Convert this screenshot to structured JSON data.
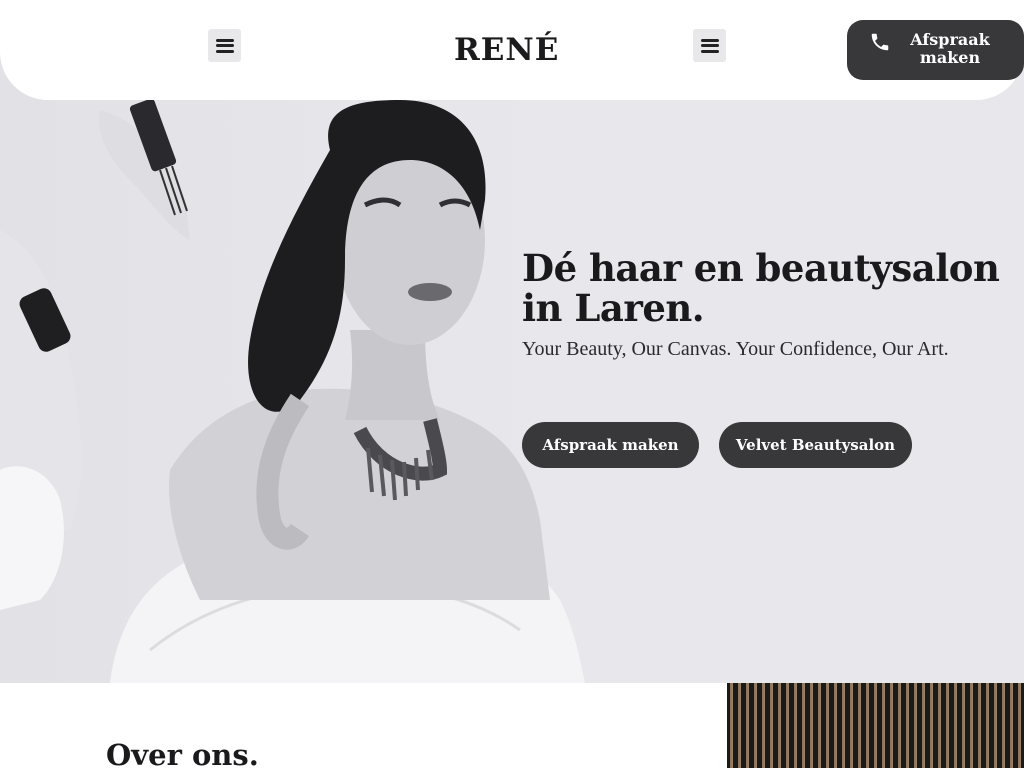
{
  "header": {
    "logo": "RENÉ",
    "menu_left_icon": "hamburger-menu-icon",
    "menu_right_icon": "hamburger-menu-icon",
    "cta_icon": "phone-icon",
    "cta_label": "Afspraak maken"
  },
  "hero": {
    "title": "Dé haar en beautysalon in Laren.",
    "subtitle": "Your Beauty, Our Canvas. Your Confidence, Our Art.",
    "primary_button": "Afspraak maken",
    "secondary_button": "Velvet Beautysalon"
  },
  "about": {
    "title": "Over ons."
  },
  "colors": {
    "button_bg": "#38383a",
    "hero_bg": "#e7e7ec",
    "text_dark": "#1a1a1c"
  }
}
